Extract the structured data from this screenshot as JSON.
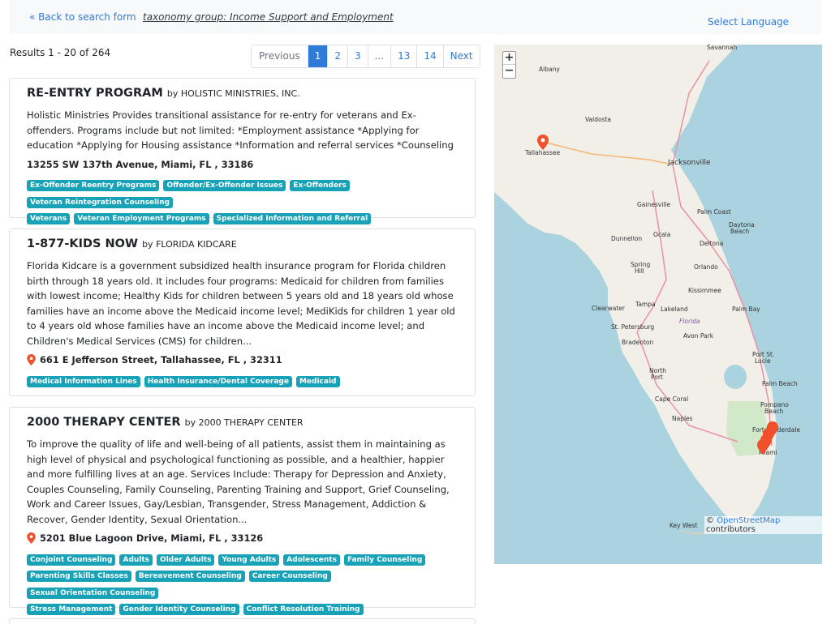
{
  "header": {
    "back_link": "« Back to search form",
    "taxonomy": "taxonomy group: Income Support and Employment",
    "select_language": "Select Language"
  },
  "results": {
    "count_text": "Results 1 - 20 of 264"
  },
  "pagination": {
    "previous": "Previous",
    "pages": [
      "1",
      "2",
      "3",
      "...",
      "13",
      "14"
    ],
    "next": "Next",
    "active_page": "1"
  },
  "listings": [
    {
      "title": "RE-ENTRY PROGRAM",
      "by": "by HOLISTIC MINISTRIES, INC.",
      "description": "Holistic Ministries Provides transitional assistance for re-entry for veterans and Ex- offenders. Programs include but not limited: *Employment assistance *Applying for education *Applying for Housing assistance *Information and referral services *Counseling",
      "address": "13255 SW 137th Avenue, Miami, FL , 33186",
      "tags": [
        "Ex-Offender Reentry Programs",
        "Offender/Ex-Offender Issues",
        "Ex-Offenders",
        "Veteran Reintegration Counseling",
        "Veterans",
        "Veteran Employment Programs",
        "Specialized Information and Referral"
      ]
    },
    {
      "title": "1-877-KIDS NOW",
      "by": "by FLORIDA KIDCARE",
      "description": "Florida Kidcare is a government subsidized health insurance program for Florida children birth through 18 years old. It includes four programs: Medicaid for children from families with lowest income; Healthy Kids for children between 5 years old and 18 years old whose families have an income above the Medicaid income level; MediKids for children 1 year old to 4 years old whose families have an income above the Medicaid income level; and Children's Medical Services (CMS) for children...",
      "address": "661 E Jefferson Street, Tallahassee, FL , 32311",
      "tags": [
        "Medical Information Lines",
        "Health Insurance/Dental Coverage",
        "Medicaid"
      ]
    },
    {
      "title": "2000 THERAPY CENTER",
      "by": "by 2000 THERAPY CENTER",
      "description": "To improve the quality of life and well-being of all patients, assist them in maintaining as high level of physical and psychological functioning as possible, and a healthier, happier and more fulfilling lives at an age. Services Include: Therapy for Depression and Anxiety, Couples Counseling, Family Counseling, Parenting Training and Support, Grief Counseling, Work and Career Issues, Gay/Lesbian, Transgender, Stress Management, Addiction & Recover, Gender Identity, Sexual Orientation...",
      "address": "5201 Blue Lagoon Drive, Miami, FL , 33126",
      "tags": [
        "Conjoint Counseling",
        "Adults",
        "Older Adults",
        "Young Adults",
        "Adolescents",
        "Family Counseling",
        "Parenting Skills Classes",
        "Bereavement Counseling",
        "Career Counseling",
        "Sexual Orientation Counseling",
        "Stress Management",
        "Gender Identity Counseling",
        "Conflict Resolution Training"
      ]
    }
  ],
  "map": {
    "zoom_in": "+",
    "zoom_out": "−",
    "attribution_symbol": "©",
    "attribution_link": "OpenStreetMap",
    "attribution_suffix": "contributors",
    "places": {
      "savannah": "Savannah",
      "albany": "Albany",
      "valdosta": "Valdosta",
      "tallahassee": "Tallahassee",
      "jacksonville": "Jacksonville",
      "gainesville": "Gainesville",
      "palm_coast": "Palm Coast",
      "daytona": "Daytona",
      "beach": "Beach",
      "dunnellon": "Dunnellon",
      "ocala": "Ocala",
      "deltona": "Deltona",
      "spring": "Spring",
      "hill": "Hill",
      "orlando": "Orlando",
      "kissimmee": "Kissimmee",
      "clearwater": "Clearwater",
      "tampa": "Tampa",
      "lakeland": "Lakeland",
      "palm_bay": "Palm Bay",
      "florida": "Florida",
      "st_petersburg": "St. Petersburg",
      "avon_park": "Avon Park",
      "bradenton": "Bradenton",
      "port_st": "Port St.",
      "lucie": "Lucie",
      "north": "North",
      "port": "Port",
      "palm_beach": "Palm Beach",
      "cape_coral": "Cape Coral",
      "pompano": "Pompano",
      "naples": "Naples",
      "fort_lauderdale": "Fort Lauderdale",
      "miami": "Miami",
      "key_west": "Key West"
    }
  },
  "colors": {
    "link": "#2f7bd8",
    "tag": "#17a2b8",
    "marker": "#f0502a",
    "water": "#aad3df",
    "land": "#f2efe9"
  }
}
